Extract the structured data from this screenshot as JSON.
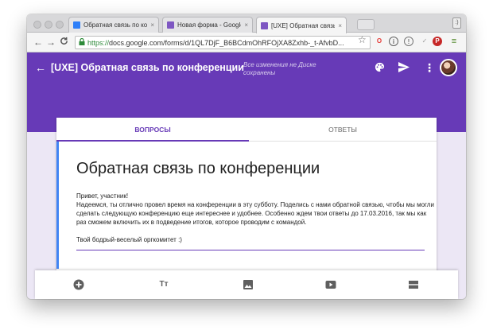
{
  "browser": {
    "tabs": [
      {
        "title": "Обратная связь по конфе",
        "close": "×",
        "favicon_color": "#2d7ff9"
      },
      {
        "title": "Новая форма - Google Фо",
        "close": "×",
        "favicon_color": "#7e57c2"
      },
      {
        "title": "[UXE] Обратная связь по",
        "close": "×",
        "favicon_color": "#7e57c2"
      }
    ],
    "side_button": ":)",
    "back": "←",
    "forward": "→",
    "reload": "C",
    "url_prefix": "https://",
    "url_rest": "docs.google.com/forms/d/1QL7DjF_B6BCdmOhRFOjXA8Zxhb-_t-AfvbD...",
    "star": "☆",
    "extensions": [
      {
        "label": "O",
        "color": "#e53935"
      },
      {
        "label": "i",
        "color": "#616161"
      },
      {
        "label": "!",
        "color": "#757575"
      },
      {
        "label": "✓",
        "color": "#9e9e9e"
      },
      {
        "label": "P",
        "color": "#c62828"
      },
      {
        "label": "≡",
        "color": "#558b2f"
      }
    ]
  },
  "app": {
    "back": "←",
    "title": "[UXE] Обратная связь по конференции",
    "saved_status": "Все изменения не Диске сохранены",
    "kebab": "⋮",
    "accent": "#673ab7"
  },
  "card": {
    "tabs": {
      "questions": "ВОПРОСЫ",
      "answers": "ОТВЕТЫ"
    },
    "heading": "Обратная связь по конференции",
    "description": {
      "greeting": "Привет, участник!",
      "body": "Надеемся, ты отлично провел время на конференции в эту субботу. Поделись с нами обратной связью, чтобы мы могли сделать следующую конференцию еще интереснее и удобнее. Особенно ждем твои ответы до 17.03.2016, так мы как раз сможем включить их в подведение итогов, которое проводим с командой.",
      "signoff": "Твой бодрый-веселый оргкомитет :)"
    }
  },
  "bottom_toolbar": {
    "add_question": "add-question-icon",
    "title_text": "Тт",
    "image": "image-icon",
    "video": "video-icon",
    "section": "section-icon"
  }
}
